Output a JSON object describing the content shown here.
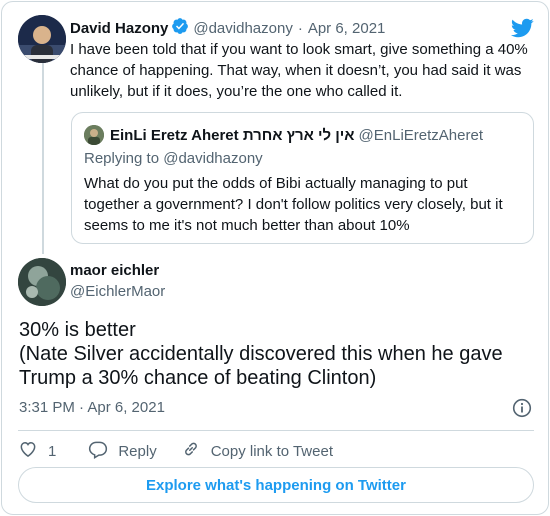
{
  "tweet": {
    "author_name": "David Hazony",
    "author_handle": "@davidhazony",
    "separator": "·",
    "date": "Apr 6, 2021",
    "text": "I have been told that if you want to look smart, give something a 40% chance of happening. That way, when it doesn’t, you had said it was unlikely, but if it does, you’re the one who called it."
  },
  "quoted": {
    "author_name": "EinLi Eretz Aheret אין לי ארץ אחרת",
    "author_handle": "@EnLiEretzAheret",
    "replying_to": "Replying to @davidhazony",
    "text": "What do you put the odds of Bibi actually managing to put together a government? I don't follow politics very closely, but it seems to me it's not much better than about 10%"
  },
  "reply": {
    "author_name": "maor eichler",
    "author_handle": "@EichlerMaor",
    "text_line1": "30% is better",
    "text_line2": "(Nate Silver accidentally discovered this when he gave Trump a 30% chance of beating Clinton)",
    "timestamp": "3:31 PM · Apr 6, 2021"
  },
  "actions": {
    "like_count": "1",
    "reply_label": "Reply",
    "copy_link_label": "Copy link to Tweet"
  },
  "footer": {
    "explore_label": "Explore what's happening on Twitter"
  },
  "icons": {
    "verified": "verified-badge-icon",
    "brand": "twitter-bird-icon",
    "info": "info-icon",
    "like": "heart-icon",
    "reply": "reply-bubble-icon",
    "link": "link-icon"
  },
  "colors": {
    "accent": "#1d9bf0",
    "text": "#0f1419",
    "muted": "#536471",
    "border": "#cfd9de"
  }
}
